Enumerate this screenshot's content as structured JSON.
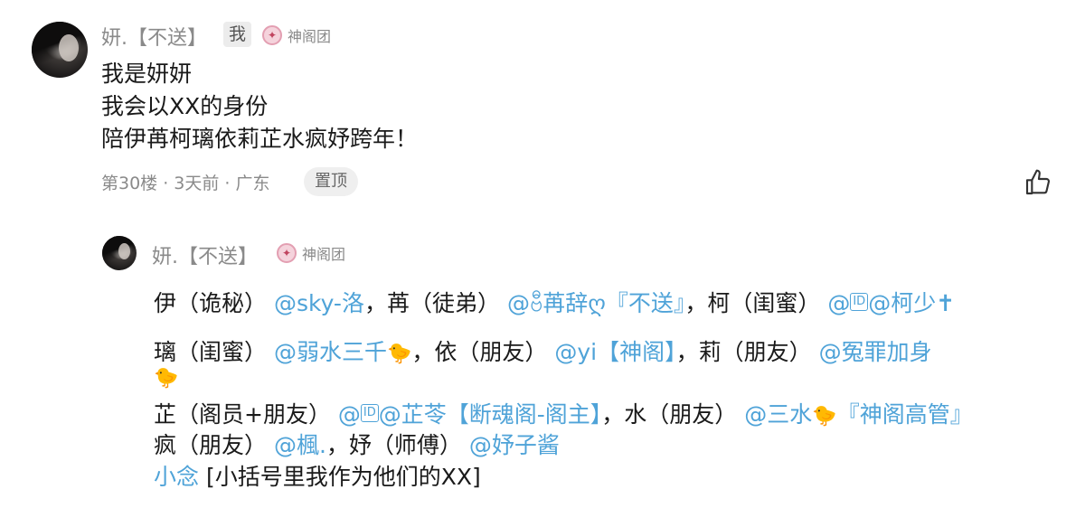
{
  "comment": {
    "username": "妍.【不送】",
    "me_badge": "我",
    "group": "神阁团",
    "lines": [
      "我是妍妍",
      "我会以XX的身份",
      "陪伊苒柯璃依莉芷水疯妤跨年！"
    ],
    "meta": "第30楼 · 3天前 · 广东",
    "pin_label": "置顶",
    "like_icon": "thumbs-up-icon"
  },
  "reply": {
    "username": "妍.【不送】",
    "group": "神阁团",
    "line1": {
      "t1": "伊（诡秘）",
      "m1": "@sky-洛",
      "t2": "，苒（徒弟）",
      "m2": "@ဗီ苒辞ღ『不送』",
      "t3": "，柯（闺蜜）",
      "id_badge": "ID",
      "m3": "@柯少",
      "m3_suffix": "✝"
    },
    "line2": {
      "t1": "璃（闺蜜）",
      "m1": "@弱水三千",
      "t2": "，依（朋友）",
      "m2": "@yi【神阁】",
      "t3": "，莉（朋友）",
      "m3": "@冤罪加身"
    },
    "line4": {
      "t1": "芷（阁员+朋友）",
      "id_badge": "ID",
      "m1": "@芷苓【断魂阁-阁主】",
      "t2": "，水（朋友）",
      "m2": "@三水",
      "m2_suffix": "『神阁高管』"
    },
    "line5": {
      "t1": "疯（朋友）",
      "m1": "@楓.",
      "t2": "，妤（师傅）",
      "m2": "@妤子酱"
    },
    "line6": {
      "m1": "小念",
      "t1": "[小括号里我作为他们的XX]"
    },
    "chick_icon": "chick-emoji-icon"
  }
}
